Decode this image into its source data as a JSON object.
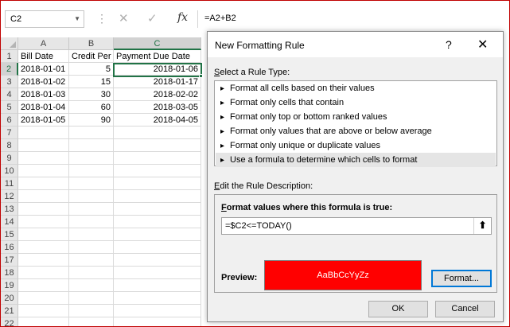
{
  "formula_bar": {
    "name_box": "C2",
    "cancel_icon": "✕",
    "enter_icon": "✓",
    "fx_label": "fx",
    "formula": "=A2+B2"
  },
  "sheet": {
    "columns": [
      "A",
      "B",
      "C"
    ],
    "selected_column": "C",
    "row_numbers": [
      "1",
      "2",
      "3",
      "4",
      "5",
      "6",
      "7",
      "8",
      "9",
      "10",
      "11",
      "12",
      "13",
      "14",
      "15",
      "16",
      "17",
      "18",
      "19",
      "20",
      "21",
      "22"
    ],
    "selected_row": "2",
    "header_row": [
      "Bill Date",
      "Credit Per",
      "Payment Due Date"
    ],
    "data_rows": [
      [
        "2018-01-01",
        "5",
        "2018-01-06"
      ],
      [
        "2018-01-02",
        "15",
        "2018-01-17"
      ],
      [
        "2018-01-03",
        "30",
        "2018-02-02"
      ],
      [
        "2018-01-04",
        "60",
        "2018-03-05"
      ],
      [
        "2018-01-05",
        "90",
        "2018-04-05"
      ]
    ]
  },
  "dialog": {
    "title": "New Formatting Rule",
    "help_icon": "?",
    "close_icon": "✕",
    "rule_type_label": "Select a Rule Type:",
    "rule_types": [
      "Format all cells based on their values",
      "Format only cells that contain",
      "Format only top or bottom ranked values",
      "Format only values that are above or below average",
      "Format only unique or duplicate values",
      "Use a formula to determine which cells to format"
    ],
    "selected_rule_index": 5,
    "description_label": "Edit the Rule Description:",
    "formula_true_label": "Format values where this formula is true:",
    "formula_value": "=$C2<=TODAY()",
    "collapse_icon": "⬆",
    "preview_label": "Preview:",
    "preview_text": "AaBbCcYyZz",
    "preview_color": "#ff0000",
    "format_button": "Format...",
    "ok_button": "OK",
    "cancel_button": "Cancel"
  }
}
